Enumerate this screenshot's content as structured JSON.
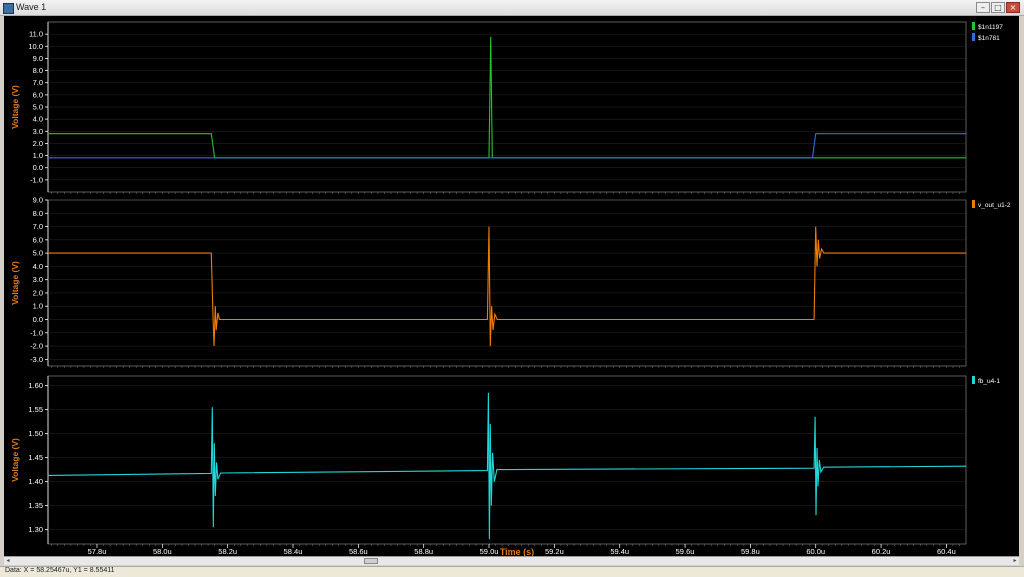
{
  "window": {
    "title": "Wave 1",
    "minimize": "–",
    "maximize": "□",
    "close": "×"
  },
  "status": "Data: X = 58.25467u,  Y1 = 8.55411",
  "scroll": {
    "left": "◂",
    "right": "▸"
  },
  "colors": {
    "bg": "#000000",
    "axis": "#ffffff",
    "label": "#e07a10",
    "grid": "#333333",
    "green": "#22c72a",
    "blue": "#2f6fe0",
    "orange": "#f07c00",
    "cyan": "#20d8d8",
    "frame": "#9a9a9a"
  },
  "chart_data": [
    {
      "type": "line",
      "ylabel": "Voltage (V)",
      "xlabel": "",
      "ylim": [
        -2.0,
        12.0
      ],
      "yticks": [
        "11.0",
        "10.0",
        "9.0",
        "8.0",
        "7.0",
        "6.0",
        "5.0",
        "4.0",
        "3.0",
        "2.0",
        "1.0",
        "0.0",
        "-1.0"
      ],
      "series": [
        {
          "name": "$1n1197",
          "color": "green",
          "points": [
            [
              57.65,
              2.8
            ],
            [
              58.15,
              2.8
            ],
            [
              58.16,
              0.82
            ],
            [
              59.0,
              0.82
            ],
            [
              59.005,
              10.8
            ],
            [
              59.01,
              0.82
            ],
            [
              60.46,
              0.82
            ]
          ]
        },
        {
          "name": "$1n781",
          "color": "blue",
          "points": [
            [
              57.65,
              0.82
            ],
            [
              59.99,
              0.82
            ],
            [
              60.0,
              2.8
            ],
            [
              60.46,
              2.8
            ]
          ]
        }
      ]
    },
    {
      "type": "line",
      "ylabel": "Voltage (V)",
      "xlabel": "",
      "ylim": [
        -3.5,
        9.0
      ],
      "yticks": [
        "9.0",
        "8.0",
        "7.0",
        "6.0",
        "5.0",
        "4.0",
        "3.0",
        "2.0",
        "1.0",
        "0.0",
        "-1.0",
        "-2.0",
        "-3.0"
      ],
      "series": [
        {
          "name": "v_out_u1-2",
          "color": "orange",
          "points": [
            [
              57.65,
              5.0
            ],
            [
              58.15,
              5.0
            ],
            [
              58.155,
              0.2
            ],
            [
              58.158,
              -2.0
            ],
            [
              58.162,
              1.0
            ],
            [
              58.165,
              -0.8
            ],
            [
              58.17,
              0.5
            ],
            [
              58.175,
              0.0
            ],
            [
              58.995,
              0.0
            ],
            [
              59.0,
              7.0
            ],
            [
              59.004,
              -2.0
            ],
            [
              59.008,
              1.0
            ],
            [
              59.012,
              -0.8
            ],
            [
              59.018,
              0.4
            ],
            [
              59.025,
              0.0
            ],
            [
              59.995,
              0.0
            ],
            [
              60.0,
              7.0
            ],
            [
              60.004,
              4.0
            ],
            [
              60.008,
              6.0
            ],
            [
              60.012,
              4.6
            ],
            [
              60.018,
              5.3
            ],
            [
              60.025,
              5.0
            ],
            [
              60.46,
              5.0
            ]
          ]
        }
      ]
    },
    {
      "type": "line",
      "ylabel": "Voltage (V)",
      "xlabel": "Time (s)",
      "ylim": [
        1.27,
        1.62
      ],
      "xlim": [
        57.65,
        60.46
      ],
      "xticks": [
        57.8,
        58.0,
        58.2,
        58.4,
        58.6,
        58.8,
        59.0,
        59.2,
        59.4,
        59.6,
        59.8,
        60.0,
        60.2,
        60.4
      ],
      "xticklabels": [
        "57.8u",
        "58.0u",
        "58.2u",
        "58.4u",
        "58.6u",
        "58.8u",
        "59.0u",
        "59.2u",
        "59.4u",
        "59.6u",
        "59.8u",
        "60.0u",
        "60.2u",
        "60.4u"
      ],
      "yticks": [
        "1.60",
        "1.55",
        "1.50",
        "1.45",
        "1.40",
        "1.35",
        "1.30"
      ],
      "series": [
        {
          "name": "fb_u4-1",
          "color": "cyan",
          "points": [
            [
              57.65,
              1.413
            ],
            [
              58.15,
              1.417
            ],
            [
              58.153,
              1.555
            ],
            [
              58.156,
              1.305
            ],
            [
              58.159,
              1.48
            ],
            [
              58.162,
              1.37
            ],
            [
              58.166,
              1.44
            ],
            [
              58.17,
              1.405
            ],
            [
              58.178,
              1.418
            ],
            [
              58.995,
              1.423
            ],
            [
              58.998,
              1.585
            ],
            [
              59.001,
              1.28
            ],
            [
              59.004,
              1.52
            ],
            [
              59.007,
              1.35
            ],
            [
              59.011,
              1.46
            ],
            [
              59.016,
              1.4
            ],
            [
              59.024,
              1.425
            ],
            [
              59.995,
              1.428
            ],
            [
              59.998,
              1.535
            ],
            [
              60.001,
              1.33
            ],
            [
              60.004,
              1.47
            ],
            [
              60.007,
              1.39
            ],
            [
              60.011,
              1.445
            ],
            [
              60.016,
              1.42
            ],
            [
              60.024,
              1.43
            ],
            [
              60.46,
              1.432
            ]
          ]
        }
      ]
    }
  ]
}
